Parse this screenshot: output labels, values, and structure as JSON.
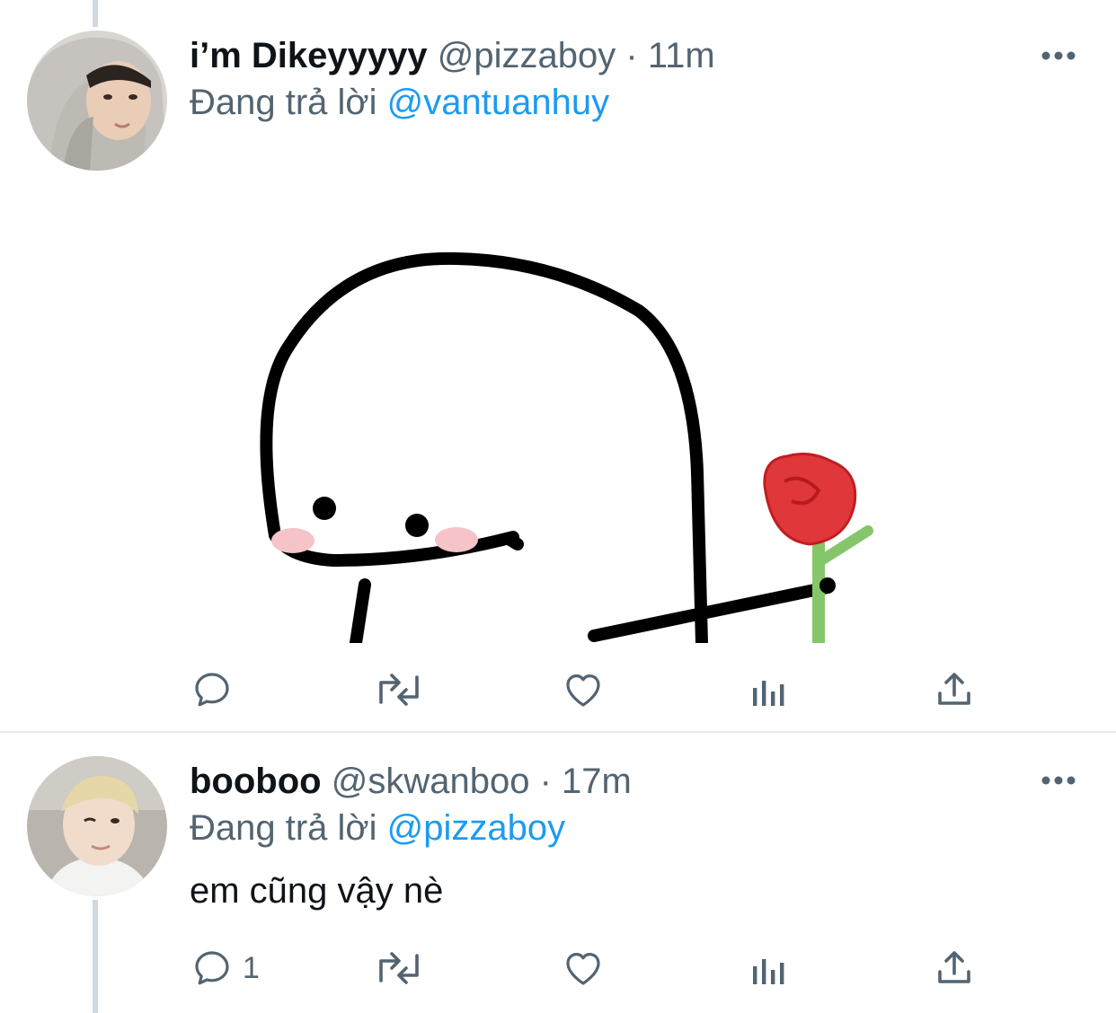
{
  "tweets": [
    {
      "name": "i’m Dikeyyyyy",
      "handle": "@pizzaboy",
      "separator": "·",
      "time": "11m",
      "reply_prefix": "Đang trả lời",
      "reply_to": "@vantuanhuy",
      "text": "",
      "actions": {
        "reply": {
          "icon": "reply-icon",
          "count": ""
        },
        "retweet": {
          "icon": "retweet-icon",
          "count": ""
        },
        "like": {
          "icon": "heart-icon",
          "count": ""
        },
        "analytics": {
          "icon": "analytics-icon",
          "count": ""
        },
        "share": {
          "icon": "share-icon",
          "count": ""
        }
      }
    },
    {
      "name": "booboo",
      "handle": "@skwanboo",
      "separator": "·",
      "time": "17m",
      "reply_prefix": "Đang trả lời",
      "reply_to": "@pizzaboy",
      "text": "em cũng vậy nè",
      "actions": {
        "reply": {
          "icon": "reply-icon",
          "count": "1"
        },
        "retweet": {
          "icon": "retweet-icon",
          "count": ""
        },
        "like": {
          "icon": "heart-icon",
          "count": ""
        },
        "analytics": {
          "icon": "analytics-icon",
          "count": ""
        },
        "share": {
          "icon": "share-icon",
          "count": ""
        }
      }
    }
  ],
  "colors": {
    "text_primary": "#0f1419",
    "text_secondary": "#536471",
    "accent": "#1d9bf0",
    "icon": "#536471",
    "thread_line": "#cfd9de"
  }
}
